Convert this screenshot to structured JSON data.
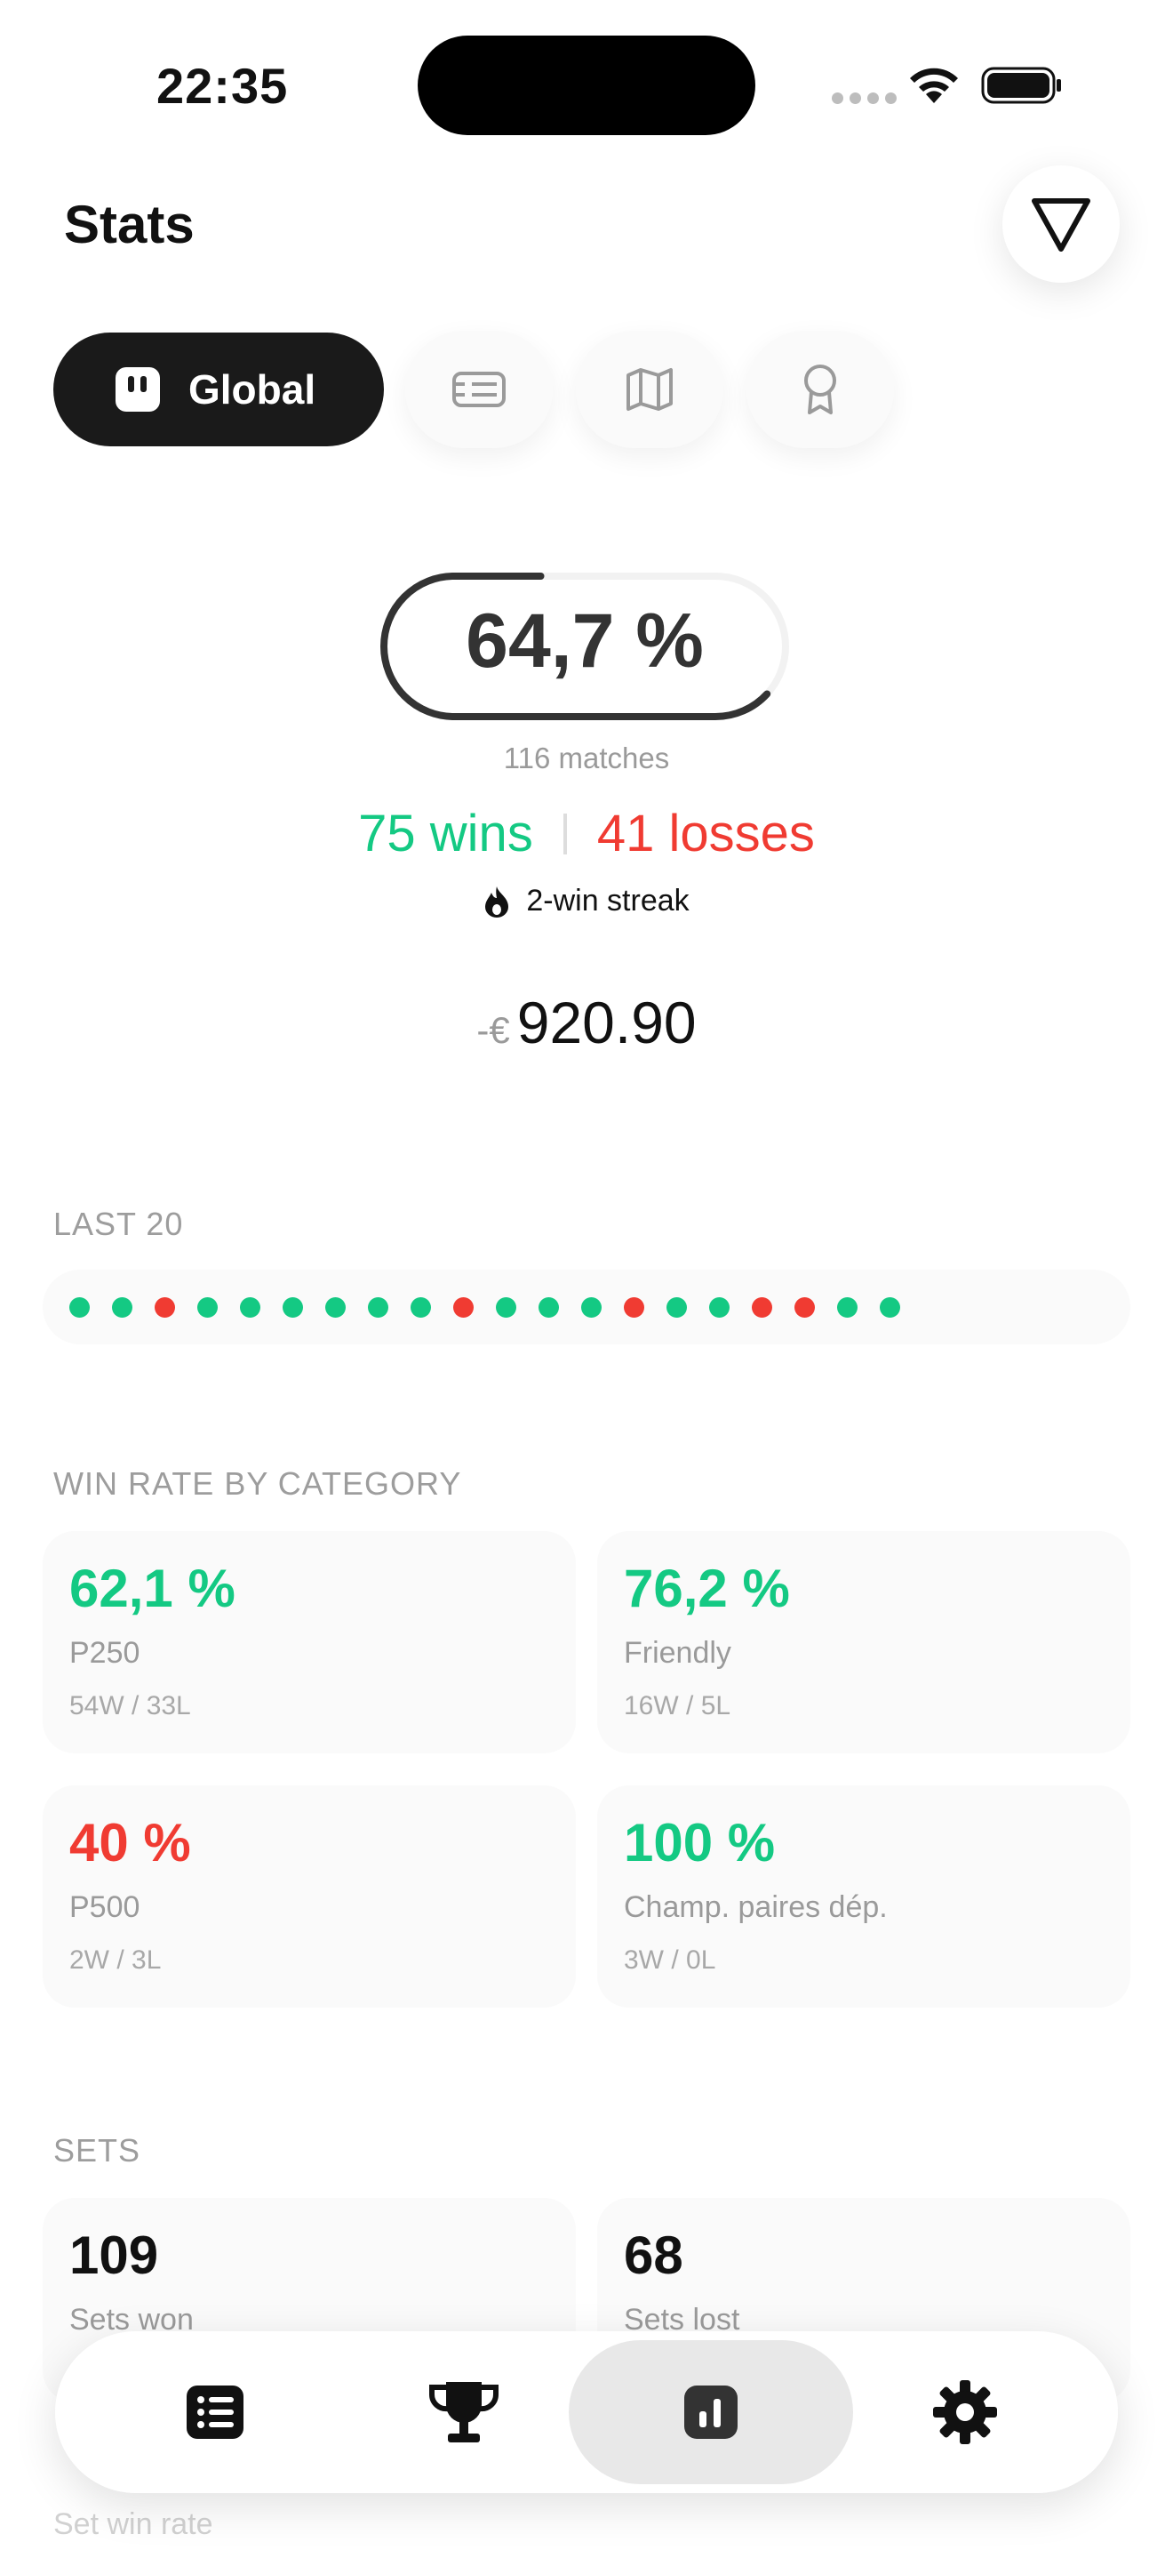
{
  "status_bar": {
    "time": "22:35"
  },
  "header": {
    "title": "Stats",
    "filter_icon": "filter-triangle-icon"
  },
  "segments": [
    {
      "label": "Global",
      "icon": "global-icon",
      "selected": true
    },
    {
      "label": "",
      "icon": "list-card-icon",
      "selected": false
    },
    {
      "label": "",
      "icon": "map-icon",
      "selected": false
    },
    {
      "label": "",
      "icon": "award-icon",
      "selected": false
    }
  ],
  "summary": {
    "win_rate": "64,7 %",
    "win_rate_value": 0.647,
    "matches": "116 matches",
    "wins": "75 wins",
    "losses": "41 losses",
    "streak": "2-win streak",
    "money_prefix": "-€",
    "money_value": "920.90"
  },
  "last20": {
    "heading": "LAST 20",
    "results": [
      "W",
      "W",
      "L",
      "W",
      "W",
      "W",
      "W",
      "W",
      "W",
      "L",
      "W",
      "W",
      "W",
      "L",
      "W",
      "W",
      "L",
      "L",
      "W",
      "W"
    ]
  },
  "category": {
    "heading": "WIN RATE BY CATEGORY",
    "cards": [
      {
        "rate": "62,1 %",
        "name": "P250",
        "record": "54W / 33L",
        "color": "#14c983"
      },
      {
        "rate": "76,2 %",
        "name": "Friendly",
        "record": "16W / 5L",
        "color": "#14c983"
      },
      {
        "rate": "40 %",
        "name": "P500",
        "record": "2W / 3L",
        "color": "#f03b32"
      },
      {
        "rate": "100 %",
        "name": "Champ. paires dép.",
        "record": "3W / 0L",
        "color": "#14c983"
      }
    ]
  },
  "sets": {
    "heading": "SETS",
    "won_value": "109",
    "won_label": "Sets won",
    "lost_value": "68",
    "lost_label": "Sets lost",
    "rate_label": "Set win rate"
  },
  "colors": {
    "win": "#14c983",
    "loss": "#f03b32",
    "dark": "#1a1a1a"
  },
  "tabbar": [
    {
      "icon": "list-icon",
      "active": false
    },
    {
      "icon": "trophy-icon",
      "active": false
    },
    {
      "icon": "stats-icon",
      "active": true
    },
    {
      "icon": "gear-icon",
      "active": false
    }
  ]
}
